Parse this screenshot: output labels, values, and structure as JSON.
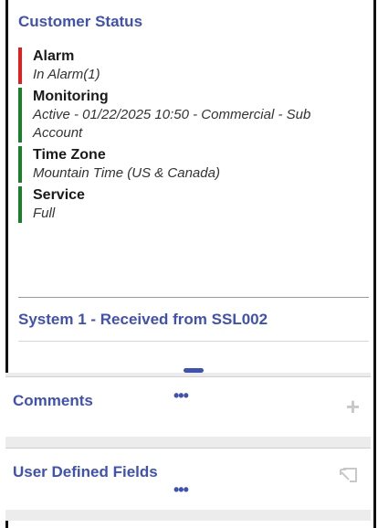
{
  "customer_status": {
    "title": "Customer Status",
    "items": [
      {
        "label": "Alarm",
        "value": "In Alarm(1)",
        "status_color": "#e02020"
      },
      {
        "label": "Monitoring",
        "value": "Active - 01/22/2025 10:50 - Commercial - Sub Account",
        "status_color": "#1a7f2a"
      },
      {
        "label": "Time Zone",
        "value": "Mountain Time (US & Canada)",
        "status_color": "#1a7f2a"
      },
      {
        "label": "Service",
        "value": "Full",
        "status_color": "#1a7f2a"
      }
    ]
  },
  "system": {
    "title": "System 1 - Received from SSL002"
  },
  "comments": {
    "title": "Comments",
    "more": "•••",
    "icon": "plus-icon"
  },
  "user_defined_fields": {
    "title": "User Defined Fields",
    "more": "•••",
    "icon": "open-external-icon"
  },
  "colors": {
    "accent": "#3f51b5",
    "alarm": "#e02020",
    "ok": "#1a7f2a"
  }
}
